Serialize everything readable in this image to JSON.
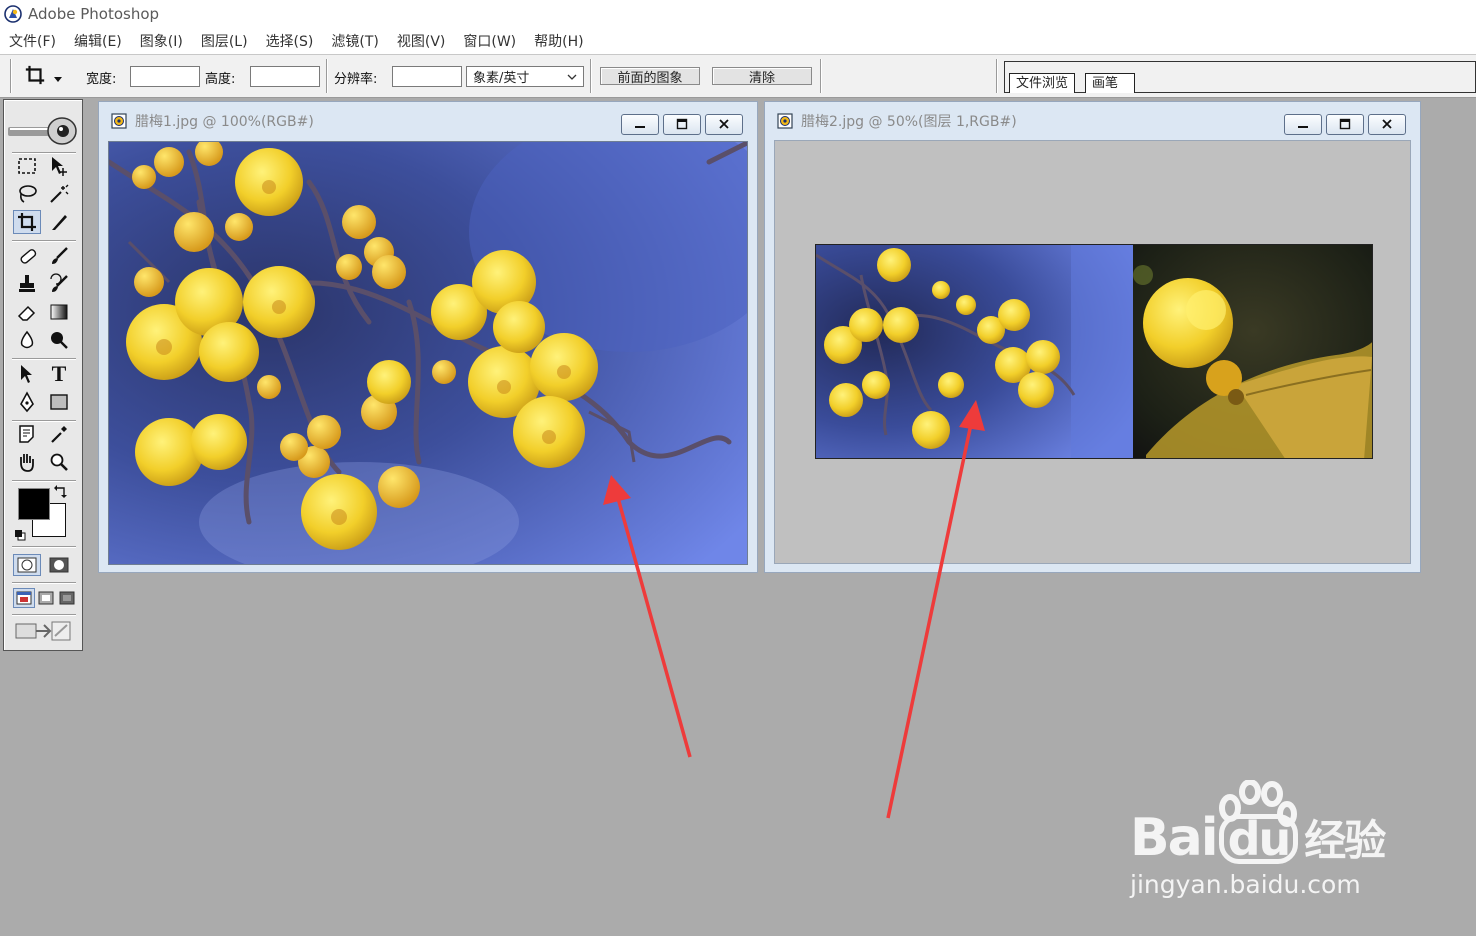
{
  "app": {
    "title": "Adobe Photoshop"
  },
  "menu": [
    "文件(F)",
    "编辑(E)",
    "图象(I)",
    "图层(L)",
    "选择(S)",
    "滤镜(T)",
    "视图(V)",
    "窗口(W)",
    "帮助(H)"
  ],
  "options": {
    "width_label": "宽度:",
    "height_label": "高度:",
    "resolution_label": "分辨率:",
    "width_value": "",
    "height_value": "",
    "resolution_value": "",
    "unit_select": "象素/英寸",
    "front_image_button": "前面的图象",
    "clear_button": "清除"
  },
  "palette_well": {
    "tabs": [
      "文件浏览",
      "画笔"
    ]
  },
  "documents": [
    {
      "title": "腊梅1.jpg @ 100%(RGB#)"
    },
    {
      "title": "腊梅2.jpg @ 50%(图层 1,RGB#)"
    }
  ],
  "toolbox": {
    "type_tool_glyph": "T"
  },
  "watermark": {
    "brand_left": "Bai",
    "brand_mid": "du",
    "brand_right": "经验",
    "url": "jingyan.baidu.com"
  },
  "colors": {
    "canvas_bg": "#ababab",
    "doc_frame": "#dce7f3",
    "blossom": "#f2cf2a",
    "arrow": "#ee3b3b",
    "photo_blue": "#5f74d0"
  }
}
